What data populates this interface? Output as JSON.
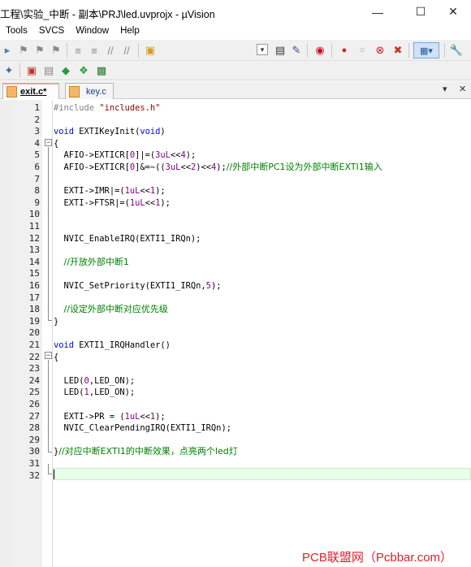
{
  "window": {
    "title": "工程\\实验_中断 - 副本\\PRJ\\led.uvprojx - µVision",
    "controls": {
      "minimize": "—",
      "maximize": "☐",
      "close": "✕"
    }
  },
  "menu": [
    "Tools",
    "SVCS",
    "Window",
    "Help"
  ],
  "tabs": [
    {
      "label": "exit.c*",
      "active": true
    },
    {
      "label": "key.c",
      "active": false
    }
  ],
  "tab_controls": {
    "dropdown": "▾",
    "close": "✕"
  },
  "code_lines": [
    {
      "n": "1",
      "text": "#include \"includes.h\""
    },
    {
      "n": "2",
      "text": ""
    },
    {
      "n": "3",
      "text": "void EXTIKeyInit(void)"
    },
    {
      "n": "4",
      "text": "{"
    },
    {
      "n": "5",
      "text": "  AFIO->EXTICR[0]|=(3uL<<4);"
    },
    {
      "n": "6",
      "text": "  AFIO->EXTICR[0]&=~((3uL<<2)<<4);//外部中断PC1设为外部中断EXTI1输入"
    },
    {
      "n": "7",
      "text": ""
    },
    {
      "n": "8",
      "text": "  EXTI->IMR|=(1uL<<1);"
    },
    {
      "n": "9",
      "text": "  EXTI->FTSR|=(1uL<<1);"
    },
    {
      "n": "10",
      "text": ""
    },
    {
      "n": "11",
      "text": ""
    },
    {
      "n": "12",
      "text": "  NVIC_EnableIRQ(EXTI1_IRQn);"
    },
    {
      "n": "13",
      "text": ""
    },
    {
      "n": "14",
      "text": "  //开放外部中断1"
    },
    {
      "n": "15",
      "text": ""
    },
    {
      "n": "16",
      "text": "  NVIC_SetPriority(EXTI1_IRQn,5);"
    },
    {
      "n": "17",
      "text": ""
    },
    {
      "n": "18",
      "text": "  //设定外部中断对应优先级"
    },
    {
      "n": "19",
      "text": "}"
    },
    {
      "n": "20",
      "text": ""
    },
    {
      "n": "21",
      "text": "void EXTI1_IRQHandler()"
    },
    {
      "n": "22",
      "text": "{"
    },
    {
      "n": "23",
      "text": ""
    },
    {
      "n": "24",
      "text": "  LED(0,LED_ON);"
    },
    {
      "n": "25",
      "text": "  LED(1,LED_ON);"
    },
    {
      "n": "26",
      "text": ""
    },
    {
      "n": "27",
      "text": "  EXTI->PR = (1uL<<1);"
    },
    {
      "n": "28",
      "text": "  NVIC_ClearPendingIRQ(EXTI1_IRQn);"
    },
    {
      "n": "29",
      "text": ""
    },
    {
      "n": "30",
      "text": "}//对应中断EXTI1的中断效果，点亮两个led灯"
    },
    {
      "n": "31",
      "text": ""
    },
    {
      "n": "32",
      "text": ""
    }
  ],
  "watermark": "PCB联盟网（Pcbbar.com）",
  "colors": {
    "keyword": "#0000ff",
    "string": "#8b0000",
    "number": "#800080",
    "comment": "#008000",
    "preprocessor": "#808080",
    "current_line": "#e8ffe8",
    "watermark": "#e0202a"
  }
}
